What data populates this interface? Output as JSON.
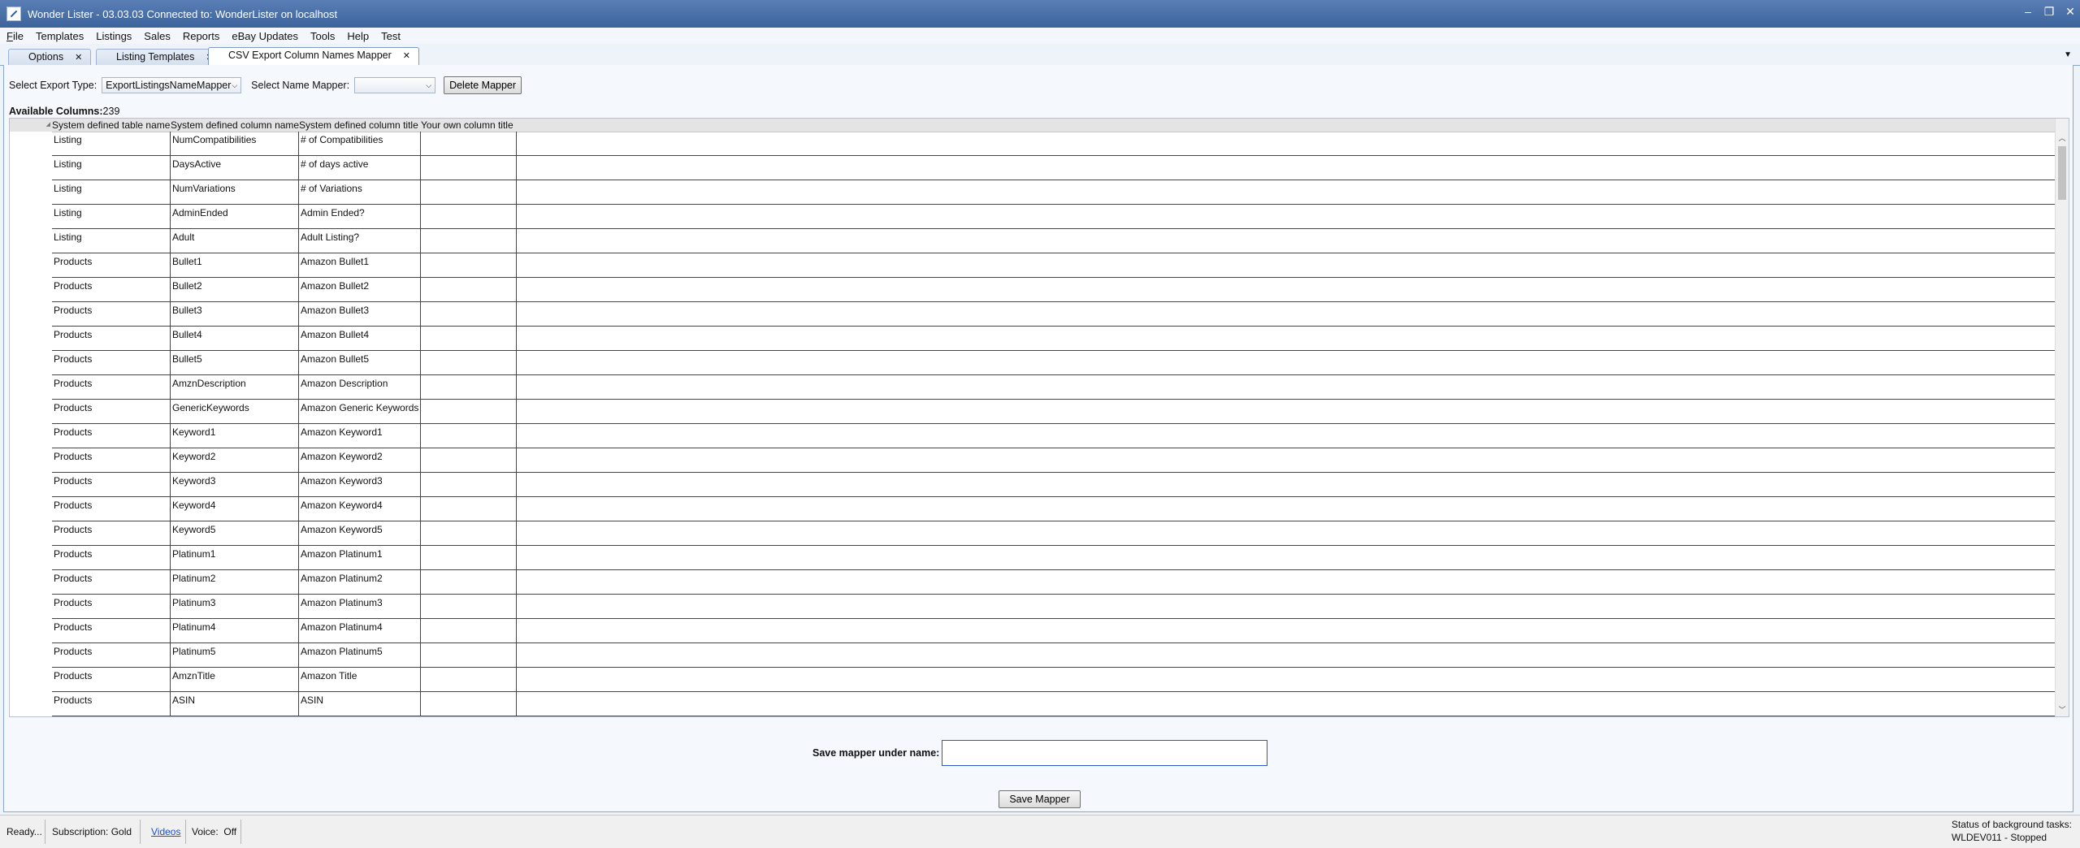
{
  "window": {
    "title": "Wonder Lister - 03.03.03 Connected to: WonderLister on localhost",
    "controls": [
      "–",
      "❐",
      "✕"
    ]
  },
  "menu": {
    "file_first": "F",
    "file_rest": "ile",
    "items": [
      "Templates",
      "Listings",
      "Sales",
      "Reports",
      "eBay Updates",
      "Tools",
      "Help",
      "Test"
    ]
  },
  "tabs": [
    {
      "label": "Options",
      "close": "✕"
    },
    {
      "label": "Listing Templates",
      "close": "✕"
    },
    {
      "label": "CSV Export Column Names Mapper",
      "close": "✕"
    }
  ],
  "toolbar": {
    "export_type_label": "Select Export Type:",
    "export_type_value": "ExportListingsNameMapper",
    "name_mapper_label": "Select Name Mapper:",
    "name_mapper_value": "",
    "delete_button": "Delete Mapper"
  },
  "available": {
    "label": "Available Columns:",
    "count": "239"
  },
  "grid": {
    "headers": [
      "System defined table name",
      "System defined column name",
      "System defined column title",
      "Your own column title"
    ],
    "rows": [
      [
        "Listing",
        "NumCompatibilities",
        "# of Compatibilities",
        ""
      ],
      [
        "Listing",
        "DaysActive",
        "# of days active",
        ""
      ],
      [
        "Listing",
        "NumVariations",
        "# of Variations",
        ""
      ],
      [
        "Listing",
        "AdminEnded",
        "Admin Ended?",
        ""
      ],
      [
        "Listing",
        "Adult",
        "Adult Listing?",
        ""
      ],
      [
        "Products",
        "Bullet1",
        "Amazon Bullet1",
        ""
      ],
      [
        "Products",
        "Bullet2",
        "Amazon Bullet2",
        ""
      ],
      [
        "Products",
        "Bullet3",
        "Amazon Bullet3",
        ""
      ],
      [
        "Products",
        "Bullet4",
        "Amazon Bullet4",
        ""
      ],
      [
        "Products",
        "Bullet5",
        "Amazon Bullet5",
        ""
      ],
      [
        "Products",
        "AmznDescription",
        "Amazon Description",
        ""
      ],
      [
        "Products",
        "GenericKeywords",
        "Amazon Generic Keywords",
        ""
      ],
      [
        "Products",
        "Keyword1",
        "Amazon Keyword1",
        ""
      ],
      [
        "Products",
        "Keyword2",
        "Amazon Keyword2",
        ""
      ],
      [
        "Products",
        "Keyword3",
        "Amazon Keyword3",
        ""
      ],
      [
        "Products",
        "Keyword4",
        "Amazon Keyword4",
        ""
      ],
      [
        "Products",
        "Keyword5",
        "Amazon Keyword5",
        ""
      ],
      [
        "Products",
        "Platinum1",
        "Amazon Platinum1",
        ""
      ],
      [
        "Products",
        "Platinum2",
        "Amazon Platinum2",
        ""
      ],
      [
        "Products",
        "Platinum3",
        "Amazon Platinum3",
        ""
      ],
      [
        "Products",
        "Platinum4",
        "Amazon Platinum4",
        ""
      ],
      [
        "Products",
        "Platinum5",
        "Amazon Platinum5",
        ""
      ],
      [
        "Products",
        "AmznTitle",
        "Amazon Title",
        ""
      ],
      [
        "Products",
        "ASIN",
        "ASIN",
        ""
      ]
    ]
  },
  "save": {
    "label": "Save mapper under name:",
    "input_value": "",
    "button": "Save Mapper"
  },
  "status": {
    "ready": "Ready...",
    "subscription": "Subscription: Gold",
    "videos": "Videos",
    "voice": "Voice:  Off",
    "bg_title": "Status of background tasks:",
    "bg_value": "WLDEV011 - Stopped"
  }
}
